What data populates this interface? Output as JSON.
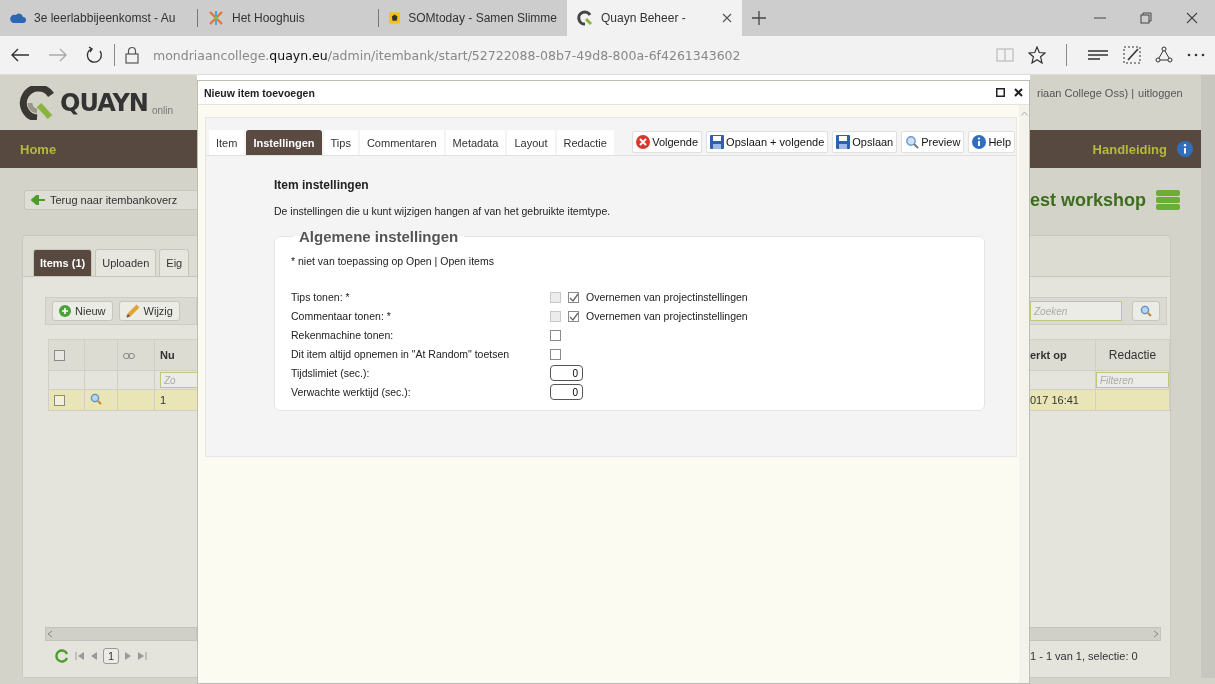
{
  "browser": {
    "tabs": [
      {
        "title": "3e leerlabbijeenkomst - Au",
        "selected": false
      },
      {
        "title": "Het Hooghuis",
        "selected": false
      },
      {
        "title": "SOMtoday - Samen Slimme",
        "selected": false
      },
      {
        "title": "Quayn Beheer -",
        "selected": true
      }
    ],
    "url": "mondriaancollege.**quayn.eu**/admin/itembank/start/52722088-08b7-49d8-800a-6f4261343602"
  },
  "background": {
    "logo": "QUAYN",
    "logo_tagline": "onlin",
    "user": "riaan College Oss) |",
    "logout": "uitloggen",
    "nav_left": "Home",
    "nav_right": "Handleiding",
    "back_button": "Terug naar itembankoverz",
    "title": "est workshop",
    "tabs": [
      {
        "label": "Items (1)",
        "selected": true
      },
      {
        "label": "Uploaden",
        "selected": false
      },
      {
        "label": "Eig",
        "selected": false
      }
    ],
    "toolbar": [
      {
        "kind": "add",
        "label": "Nieuw"
      },
      {
        "kind": "edit",
        "label": "Wijzig"
      }
    ],
    "search": {
      "placeholder": "Zoeken"
    },
    "left_table": {
      "header_checked": false,
      "column": "Nu",
      "filter_placeholder": "Zo",
      "row": {
        "checked": false,
        "cell": "1"
      }
    },
    "right_table": {
      "columns": [
        "erkt op",
        "Redactie"
      ],
      "filter_placeholder": "Filteren",
      "row_cell": "017 16:41"
    },
    "pager": {
      "page": "1",
      "status": "1 - 1 van 1, selectie: 0"
    }
  },
  "dialog": {
    "title": "Nieuw item toevoegen",
    "tabs": [
      {
        "label": "Item",
        "selected": false
      },
      {
        "label": "Instellingen",
        "selected": true
      },
      {
        "label": "Tips",
        "selected": false
      },
      {
        "label": "Commentaren",
        "selected": false
      },
      {
        "label": "Metadata",
        "selected": false
      },
      {
        "label": "Layout",
        "selected": false
      },
      {
        "label": "Redactie",
        "selected": false
      }
    ],
    "buttons": [
      {
        "kind": "cancel",
        "label": "Volgende"
      },
      {
        "kind": "save",
        "label": "Opslaan + volgende"
      },
      {
        "kind": "save",
        "label": "Opslaan"
      },
      {
        "kind": "preview",
        "label": "Preview"
      },
      {
        "kind": "help",
        "label": "Help"
      }
    ],
    "heading": "Item instellingen",
    "description": "De instellingen die u kunt wijzigen hangen af van het gebruikte itemtype.",
    "section": "Algemene instellingen",
    "note": "* niet van toepassing op Open | Open items",
    "settings": [
      {
        "kind": "inherit",
        "label": "Tips tonen: *",
        "checked": false,
        "disabled": true,
        "inherit": {
          "checked": true,
          "label": "Overnemen van projectinstellingen"
        }
      },
      {
        "kind": "inherit",
        "label": "Commentaar tonen: *",
        "checked": false,
        "disabled": true,
        "inherit": {
          "checked": true,
          "label": "Overnemen van projectinstellingen"
        }
      },
      {
        "kind": "checkbox",
        "label": "Rekenmachine tonen:",
        "checked": false,
        "disabled": false
      },
      {
        "kind": "checkbox",
        "label": "Dit item altijd opnemen in \"At Random\" toetsen",
        "checked": false,
        "disabled": false
      },
      {
        "kind": "number",
        "label": "Tijdslimiet (sec.):",
        "value": "0"
      },
      {
        "kind": "number",
        "label": "Verwachte werktijd (sec.):",
        "value": "0"
      }
    ]
  }
}
